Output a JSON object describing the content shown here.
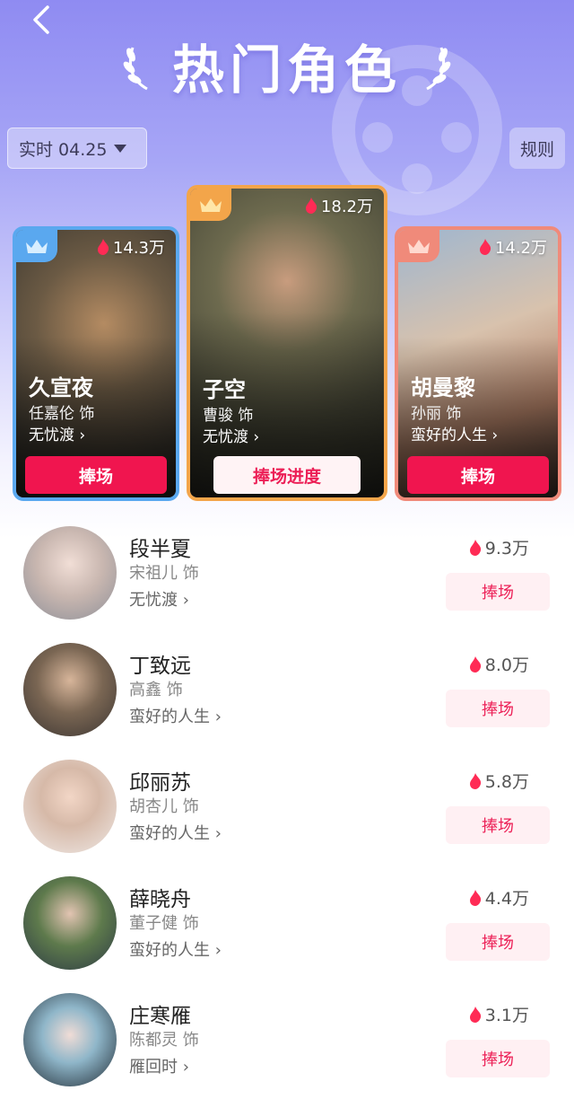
{
  "nav": {
    "back_glyph": "‹"
  },
  "header": {
    "title": "热门角色",
    "date_filter": "实时 04.25",
    "rules": "规则"
  },
  "colors": {
    "accent_red": "#f0154f",
    "light_pink": "#fff0f3",
    "hero_purple": "#8f8bf2",
    "card_blue": "#5aa8ef",
    "card_gold": "#f3a54a",
    "card_coral": "#f08a7a"
  },
  "podium": [
    {
      "rank_icon": "crown-icon",
      "heat": "18.2万",
      "name": "子空",
      "actor": "曹骏 饰",
      "drama": "无忧渡 ›",
      "button": "捧场进度"
    },
    {
      "rank_icon": "crown-icon",
      "heat": "14.3万",
      "name": "久宣夜",
      "actor": "任嘉伦 饰",
      "drama": "无忧渡 ›",
      "button": "捧场"
    },
    {
      "rank_icon": "crown-icon",
      "heat": "14.2万",
      "name": "胡曼黎",
      "actor": "孙丽 饰",
      "drama": "蛮好的人生 ›",
      "button": "捧场"
    }
  ],
  "list": [
    {
      "name": "段半夏",
      "actor": "宋祖儿 饰",
      "drama": "无忧渡 ›",
      "heat": "9.3万",
      "button": "捧场"
    },
    {
      "name": "丁致远",
      "actor": "高鑫 饰",
      "drama": "蛮好的人生 ›",
      "heat": "8.0万",
      "button": "捧场"
    },
    {
      "name": "邱丽苏",
      "actor": "胡杏儿 饰",
      "drama": "蛮好的人生 ›",
      "heat": "5.8万",
      "button": "捧场"
    },
    {
      "name": "薛晓舟",
      "actor": "董子健 饰",
      "drama": "蛮好的人生 ›",
      "heat": "4.4万",
      "button": "捧场"
    },
    {
      "name": "庄寒雁",
      "actor": "陈都灵 饰",
      "drama": "雁回时 ›",
      "heat": "3.1万",
      "button": "捧场"
    }
  ]
}
